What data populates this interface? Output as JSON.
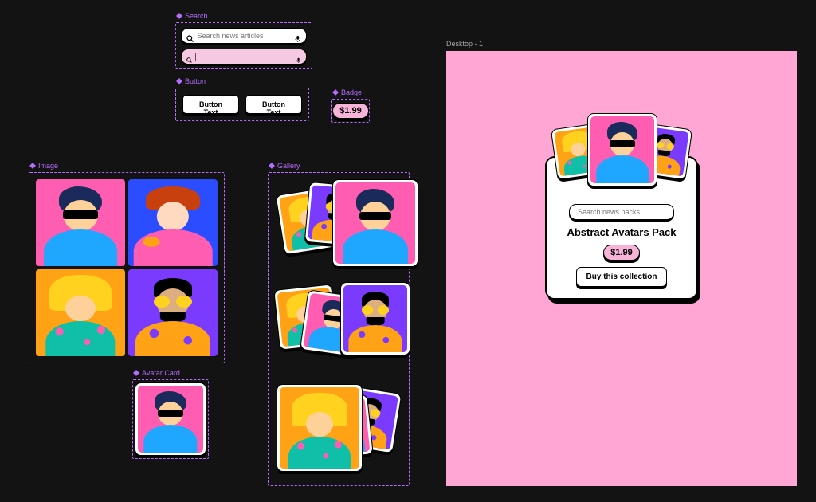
{
  "frames": {
    "search": "Search",
    "button": "Button",
    "badge": "Badge",
    "image": "Image",
    "gallery": "Gallery",
    "avatar_card": "Avatar Card",
    "desktop": "Desktop - 1"
  },
  "search": {
    "placeholder_default": "Search news articles",
    "placeholder_focused": ""
  },
  "buttons": {
    "primary": "Button Text",
    "secondary": "Button Text"
  },
  "badge": {
    "price": "$1.99"
  },
  "avatars": {
    "a1": "blue-hoodie-sunglasses",
    "a2": "red-hair-glasses",
    "a3": "yellow-beanie-long-hair",
    "a4": "beard-yellow-glasses"
  },
  "product": {
    "search_placeholder": "Search news packs",
    "title": "Abstract Avatars Pack",
    "price": "$1.99",
    "buy_label": "Buy this collection"
  },
  "colors": {
    "canvas": "#131313",
    "frame_border": "#b66cff",
    "desktop_bg": "#ffa6d5",
    "badge_bg": "#f8b3d9"
  }
}
